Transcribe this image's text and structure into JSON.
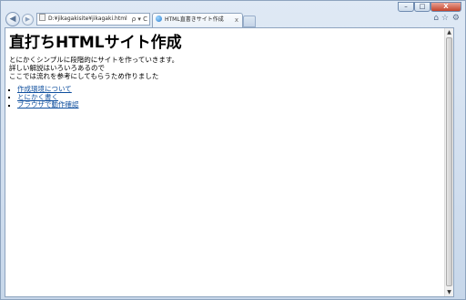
{
  "window": {
    "minimize": "–",
    "maximize": "□",
    "close": "X"
  },
  "nav": {
    "back": "◀",
    "forward": "▶"
  },
  "address": {
    "url": "D:¥jikagakisite¥jikagaki.html",
    "tools": "ρ ▾ C"
  },
  "tab": {
    "title": "HTML直書きサイト作成",
    "close": "x"
  },
  "toolbar_right": {
    "home_icon": "home-icon",
    "favorites_icon": "star-icon",
    "tools_icon": "gear-icon"
  },
  "page": {
    "heading": "直打ちHTMLサイト作成",
    "lines": [
      "とにかくシンプルに段階的にサイトを作っていきます。",
      "詳しい解説はいろいろあるので",
      "ここでは流れを参考にしてもらうため作りました"
    ],
    "links": [
      "作成環境について",
      "とにかく書く",
      "ブラウザで動作確認"
    ]
  },
  "scrollbar": {
    "up": "▲",
    "down": "▼"
  }
}
